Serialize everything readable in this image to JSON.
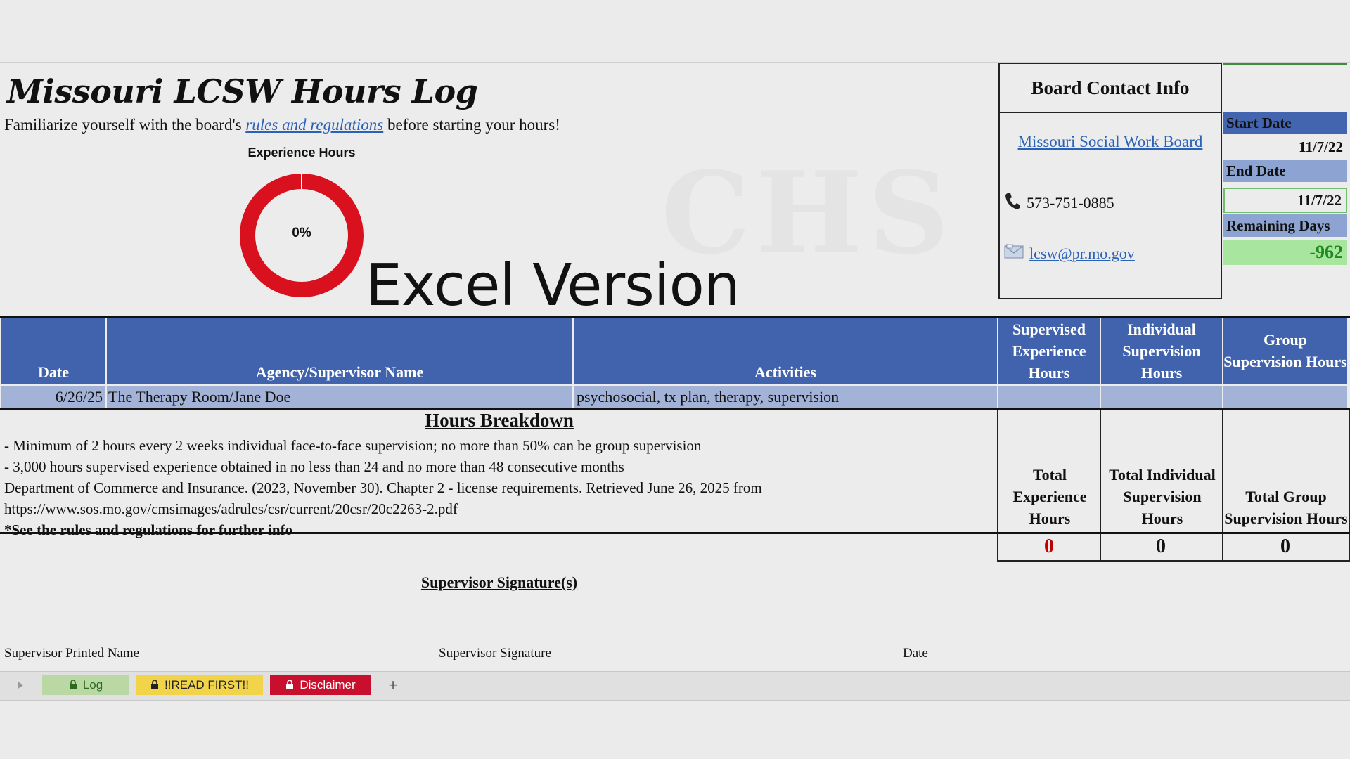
{
  "title": "Missouri LCSW Hours Log",
  "intro": {
    "before": "Familiarize yourself with the board's",
    "link": "rules and regulations",
    "after": "before starting your hours!"
  },
  "chart_data": {
    "type": "pie",
    "title": "Experience Hours",
    "center_label": "0%",
    "progress_fraction": 0.0,
    "colors": {
      "remaining": "#d9101d",
      "completed": "#ffffff"
    }
  },
  "watermark_text": "Excel Version",
  "board": {
    "heading": "Board Contact Info",
    "link": "Missouri Social Work Board",
    "phone_icon": "phone-icon",
    "phone": "573-751-0885",
    "email_icon": "email-icon",
    "email": "lcsw@pr.mo.gov"
  },
  "dates": {
    "start_label": "Start Date",
    "start_value": "11/7/22",
    "end_label": "End Date",
    "end_value": "11/7/22",
    "remaining_label": "Remaining Days",
    "remaining_value": "-962"
  },
  "table": {
    "headers": {
      "date": "Date",
      "agency": "Agency/Supervisor Name",
      "activities": "Activities",
      "supervised": "Supervised Experience Hours",
      "individual": "Individual Supervision Hours",
      "group": "Group Supervision Hours"
    },
    "rows": [
      {
        "date": "6/26/25",
        "agency": "The Therapy Room/Jane Doe",
        "activities": "psychosocial, tx plan, therapy, supervision",
        "supervised": "",
        "individual": "",
        "group": ""
      }
    ]
  },
  "breakdown": {
    "heading": "Hours Breakdown",
    "lines": [
      "- Minimum of 2 hours every 2 weeks individual face-to-face supervision; no more than 50% can be group supervision",
      "- 3,000 hours supervised experience obtained in no less than 24 and no more than 48 consecutive months",
      "Department of Commerce and Insurance. (2023, November 30). Chapter 2 - license requirements. Retrieved June 26, 2025 from",
      "https://www.sos.mo.gov/cmsimages/adrules/csr/current/20csr/20c2263-2.pdf",
      "*See the rules and regulations for further info"
    ]
  },
  "totals": {
    "experience_label": "Total Experience Hours",
    "individual_label": "Total Individual Supervision Hours",
    "group_label": "Total Group Supervision Hours",
    "experience_value": "0",
    "individual_value": "0",
    "group_value": "0"
  },
  "signature": {
    "heading": "Supervisor Signature(s)",
    "printed_name": "Supervisor Printed Name",
    "signature": "Supervisor Signature",
    "date": "Date"
  },
  "tabs": [
    {
      "label": "Log",
      "color": "#b9d8a4",
      "text_color": "#2e6a1e"
    },
    {
      "label": "!!READ FIRST!!",
      "color": "#f2d44a",
      "text_color": "#222222"
    },
    {
      "label": "Disclaimer",
      "color": "#c8102e",
      "text_color": "#ffffff"
    }
  ],
  "add_sheet_icon": "plus-icon",
  "colors": {
    "header_blue": "#4163ad",
    "row_blue": "#a3b3d8",
    "remaining_green": "#a8e6a0",
    "remaining_text": "#1e8a1e",
    "total_red": "#c00000"
  }
}
